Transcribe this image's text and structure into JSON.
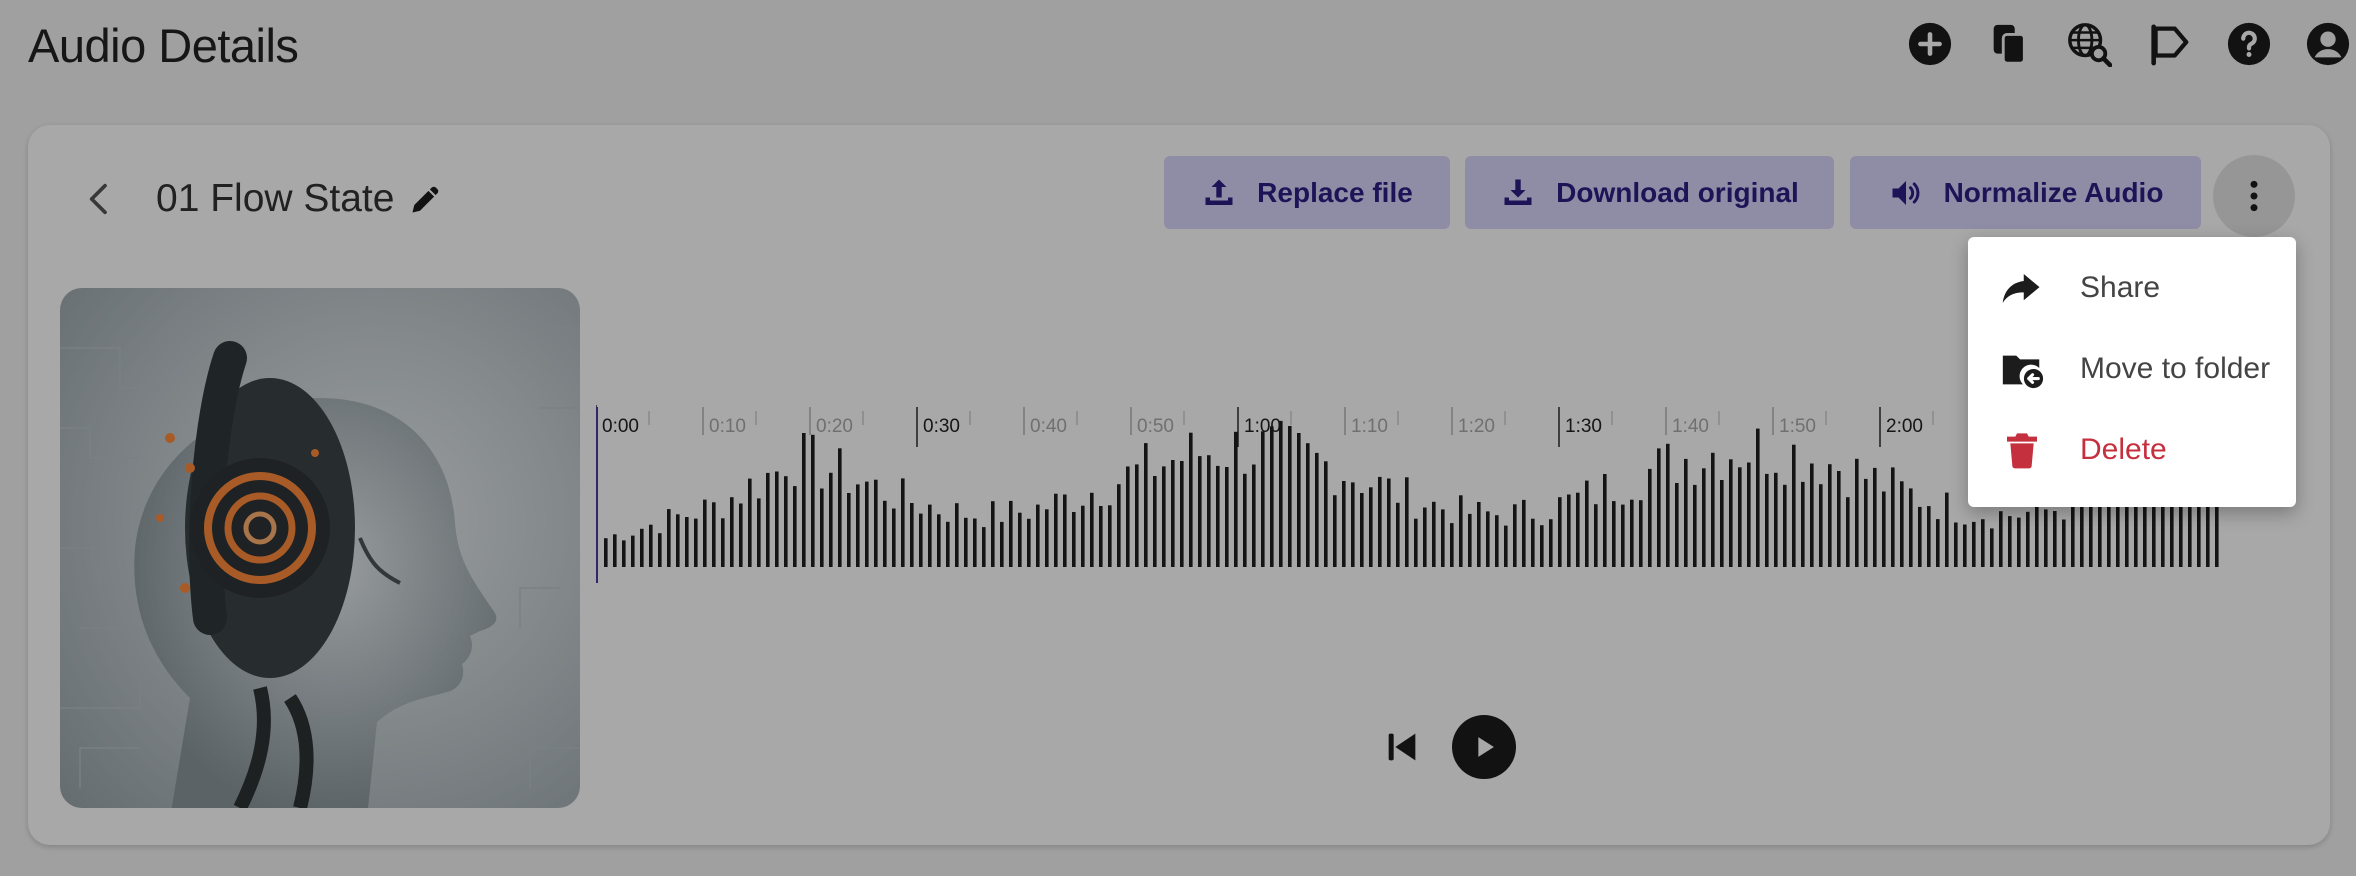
{
  "header": {
    "title": "Audio Details",
    "icons": [
      "add-icon",
      "copy-icon",
      "web-search-icon",
      "flag-icon",
      "help-icon",
      "account-icon"
    ]
  },
  "audio": {
    "title": "01 Flow State",
    "cover_alt": "robot with headphones",
    "played_fraction": 0.0
  },
  "actions": {
    "replace_label": "Replace file",
    "download_label": "Download original",
    "normalize_label": "Normalize Audio"
  },
  "timeline": {
    "ticks": [
      "0:00",
      "0:10",
      "0:20",
      "0:30",
      "0:40",
      "0:50",
      "1:00",
      "1:10",
      "1:20",
      "1:30",
      "1:40",
      "1:50",
      "2:00"
    ],
    "major_ticks": [
      "0:00",
      "0:30",
      "1:00",
      "1:30",
      "2:00"
    ]
  },
  "menu": {
    "items": [
      {
        "label": "Share",
        "icon": "share-icon"
      },
      {
        "label": "Move to folder",
        "icon": "move-folder-icon"
      },
      {
        "label": "Delete",
        "icon": "trash-icon",
        "color": "#c5303f"
      }
    ]
  },
  "colors": {
    "accent": "#2c1f86",
    "button_bg": "#d9d5fb",
    "danger": "#c5303f",
    "playhead": "#4a3aa8"
  }
}
